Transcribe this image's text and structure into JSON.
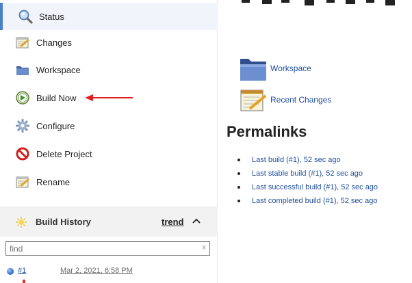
{
  "sidebar": {
    "tasks": [
      {
        "label": "Status",
        "icon": "magnifier-icon"
      },
      {
        "label": "Changes",
        "icon": "notepad-icon"
      },
      {
        "label": "Workspace",
        "icon": "folder-icon"
      },
      {
        "label": "Build Now",
        "icon": "clock-play-icon"
      },
      {
        "label": "Configure",
        "icon": "gear-icon"
      },
      {
        "label": "Delete Project",
        "icon": "no-entry-icon"
      },
      {
        "label": "Rename",
        "icon": "notepad-icon"
      }
    ],
    "build_history": {
      "title": "Build History",
      "trend_label": "trend",
      "find_placeholder": "find",
      "clear_label": "x",
      "builds": [
        {
          "number": "#1",
          "date": "Mar 2, 2021, 6:58 PM"
        }
      ]
    }
  },
  "main": {
    "links": [
      {
        "label": "Workspace",
        "icon": "folder-icon"
      },
      {
        "label": "Recent Changes",
        "icon": "notepad-icon"
      }
    ],
    "permalinks_title": "Permalinks",
    "permalinks": [
      "Last build (#1), 52 sec ago",
      "Last stable build (#1), 52 sec ago",
      "Last successful build (#1), 52 sec ago",
      "Last completed build (#1), 52 sec ago"
    ]
  },
  "colors": {
    "link": "#1f4e9c",
    "active_bg": "#f1f4fa",
    "active_border": "#4b80c9",
    "annotation_arrow": "#e11d1d"
  }
}
